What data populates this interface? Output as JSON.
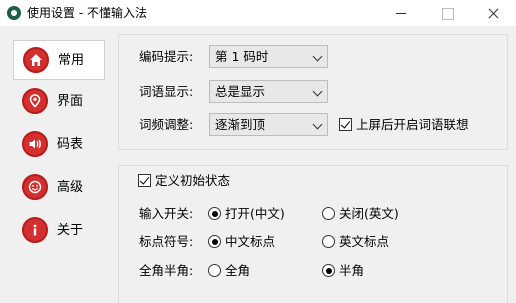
{
  "window": {
    "title": "使用设置 - 不懂输入法",
    "app_icon": "app-logo-icon",
    "controls": [
      "minimize-icon",
      "maximize-icon",
      "close-icon"
    ]
  },
  "sidebar": {
    "accent_color": "#d32f2f",
    "items": [
      {
        "label": "常用",
        "icon": "home-icon",
        "active": true
      },
      {
        "label": "界面",
        "icon": "location-pin-icon",
        "active": false
      },
      {
        "label": "码表",
        "icon": "speaker-icon",
        "active": false
      },
      {
        "label": "高级",
        "icon": "face-icon",
        "active": false
      },
      {
        "label": "关于",
        "icon": "info-icon",
        "active": false
      }
    ]
  },
  "general": {
    "code_hint": {
      "label": "编码提示:",
      "value": "第 1 码时"
    },
    "phrase_display": {
      "label": "词语显示:",
      "value": "总是显示"
    },
    "freq_adjust": {
      "label": "词频调整:",
      "value": "逐渐到顶"
    },
    "association": {
      "label": "上屏后开启词语联想",
      "checked": true
    }
  },
  "initial_state": {
    "title": "定义初始状态",
    "checked": true,
    "rows": [
      {
        "label": "输入开关:",
        "option_a": "打开(中文)",
        "option_b": "关闭(英文)",
        "selected": "a"
      },
      {
        "label": "标点符号:",
        "option_a": "中文标点",
        "option_b": "英文标点",
        "selected": "a"
      },
      {
        "label": "全角半角:",
        "option_a": "全角",
        "option_b": "半角",
        "selected": "b"
      }
    ]
  }
}
